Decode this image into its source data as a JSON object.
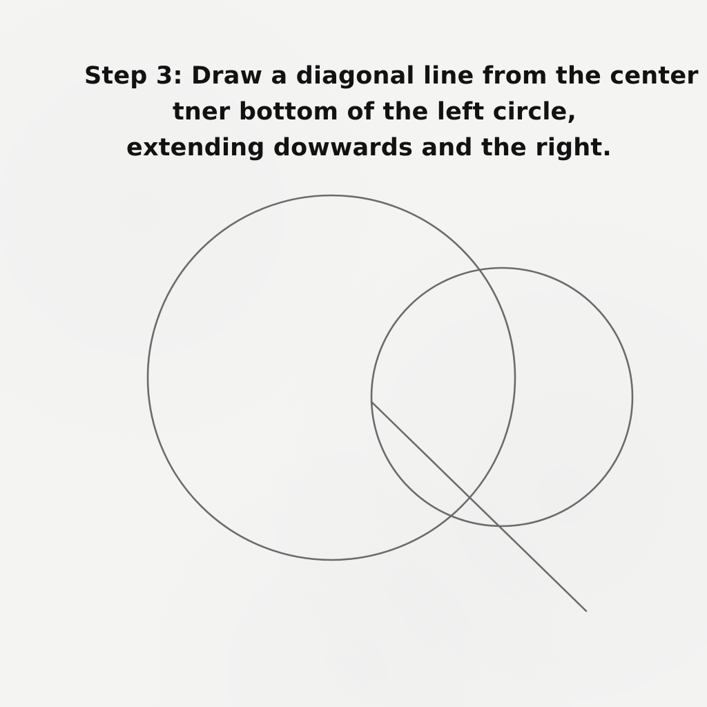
{
  "instructions": {
    "line1": "Step 3: Draw a diagonal line from the center",
    "line2": "tner bottom of the left circle,",
    "line3": "extending dowwards and the right."
  },
  "colors": {
    "background": "#f4f4f3",
    "text": "#121212",
    "stroke": "#6b6b6b"
  }
}
